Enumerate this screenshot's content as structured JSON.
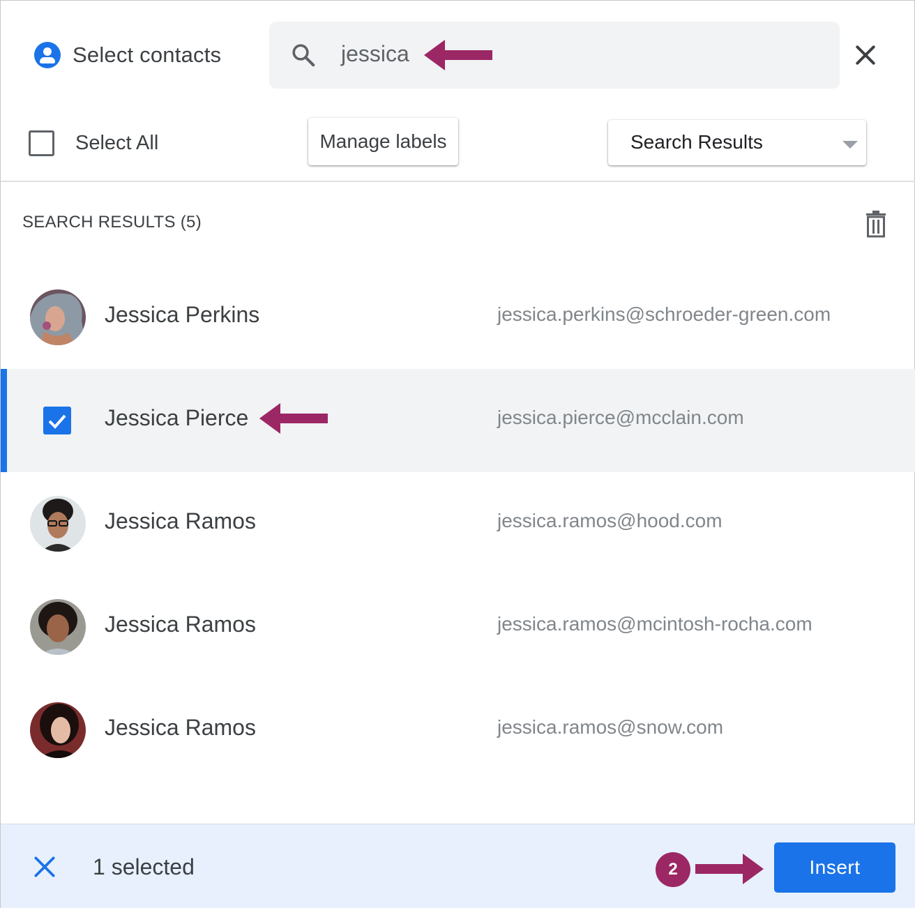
{
  "header": {
    "title": "Select contacts",
    "icon": "account-circle-icon",
    "search_value": "jessica",
    "close_icon": "close-icon"
  },
  "toolbar": {
    "select_all_label": "Select All",
    "manage_labels_label": "Manage labels",
    "dropdown_value": "Search Results"
  },
  "list": {
    "section_title": "SEARCH RESULTS (5)",
    "contacts": [
      {
        "name": "Jessica Perkins",
        "email": "jessica.perkins@schroeder-green.com",
        "selected": false
      },
      {
        "name": "Jessica Pierce",
        "email": "jessica.pierce@mcclain.com",
        "selected": true
      },
      {
        "name": "Jessica Ramos",
        "email": "jessica.ramos@hood.com",
        "selected": false
      },
      {
        "name": "Jessica Ramos",
        "email": "jessica.ramos@mcintosh-rocha.com",
        "selected": false
      },
      {
        "name": "Jessica Ramos",
        "email": "jessica.ramos@snow.com",
        "selected": false
      }
    ]
  },
  "footer": {
    "selected_text": "1 selected",
    "step_badge": "2",
    "insert_label": "Insert"
  },
  "colors": {
    "accent": "#1a73e8",
    "annotation": "#9c2765",
    "selected_row": "#f1f3f4",
    "footer_bg": "#e8f0fe"
  }
}
